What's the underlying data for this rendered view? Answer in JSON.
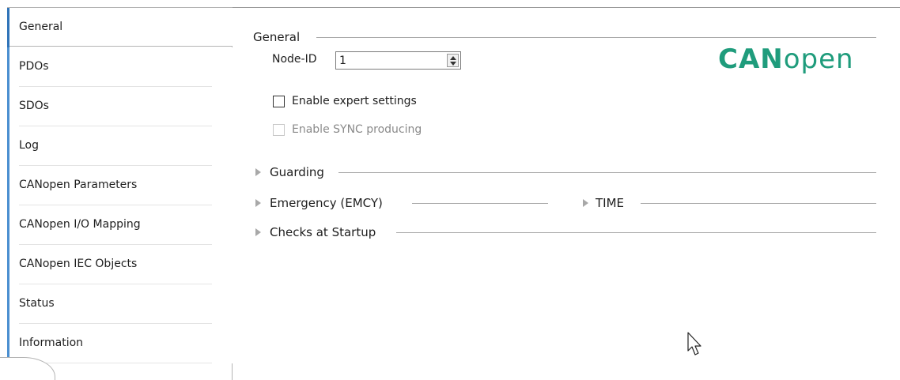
{
  "sidebar": {
    "items": [
      {
        "label": "General",
        "active": true
      },
      {
        "label": "PDOs"
      },
      {
        "label": "SDOs"
      },
      {
        "label": "Log"
      },
      {
        "label": "CANopen Parameters"
      },
      {
        "label": "CANopen I/O Mapping"
      },
      {
        "label": "CANopen IEC Objects"
      },
      {
        "label": "Status"
      },
      {
        "label": "Information"
      }
    ]
  },
  "general": {
    "title": "General",
    "node_id_label": "Node-ID",
    "node_id_value": "1",
    "expert_label": "Enable expert settings",
    "expert_checked": false,
    "sync_label": "Enable SYNC producing",
    "sync_checked": false,
    "sync_enabled": false
  },
  "logo": {
    "bold": "CAN",
    "light": "open",
    "color": "#1f9c7c"
  },
  "sections": {
    "guarding": "Guarding",
    "emergency": "Emergency  (EMCY)",
    "time": "TIME",
    "checks": "Checks at Startup"
  },
  "colors": {
    "accent": "#4b8fd0",
    "logo": "#1f9c7c"
  }
}
